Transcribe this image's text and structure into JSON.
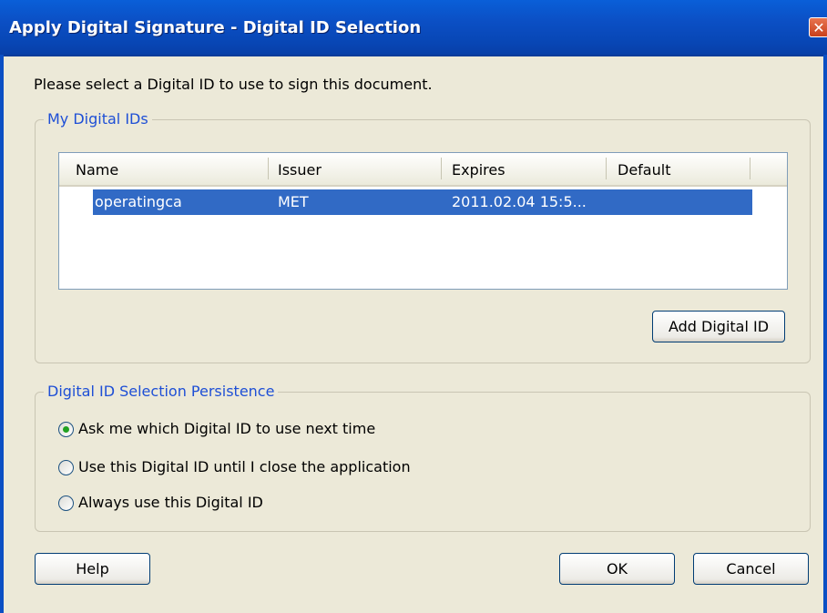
{
  "window": {
    "title": "Apply Digital Signature - Digital ID Selection",
    "close_symbol": "✕"
  },
  "prompt": "Please select a Digital ID to use to sign this document.",
  "digital_ids": {
    "group_label": "My Digital IDs",
    "columns": [
      "Name",
      "Issuer",
      "Expires",
      "Default"
    ],
    "rows": [
      {
        "name": "operatingca",
        "issuer": "MET",
        "expires": "2011.02.04 15:5...",
        "default": "",
        "selected": true
      }
    ],
    "add_button": "Add Digital ID"
  },
  "persistence": {
    "group_label": "Digital ID Selection Persistence",
    "options": [
      {
        "label": "Ask me which Digital ID to use next time",
        "checked": true
      },
      {
        "label": "Use this Digital ID until I close the application",
        "checked": false
      },
      {
        "label": "Always use this Digital ID",
        "checked": false
      }
    ]
  },
  "buttons": {
    "help": "Help",
    "ok": "OK",
    "cancel": "Cancel"
  },
  "colors": {
    "titlebar": "#0b4fc4",
    "selection": "#316ac5",
    "group_label": "#1e4fd6",
    "radio_dot": "#21a121",
    "dialog_bg": "#ece9d8"
  }
}
